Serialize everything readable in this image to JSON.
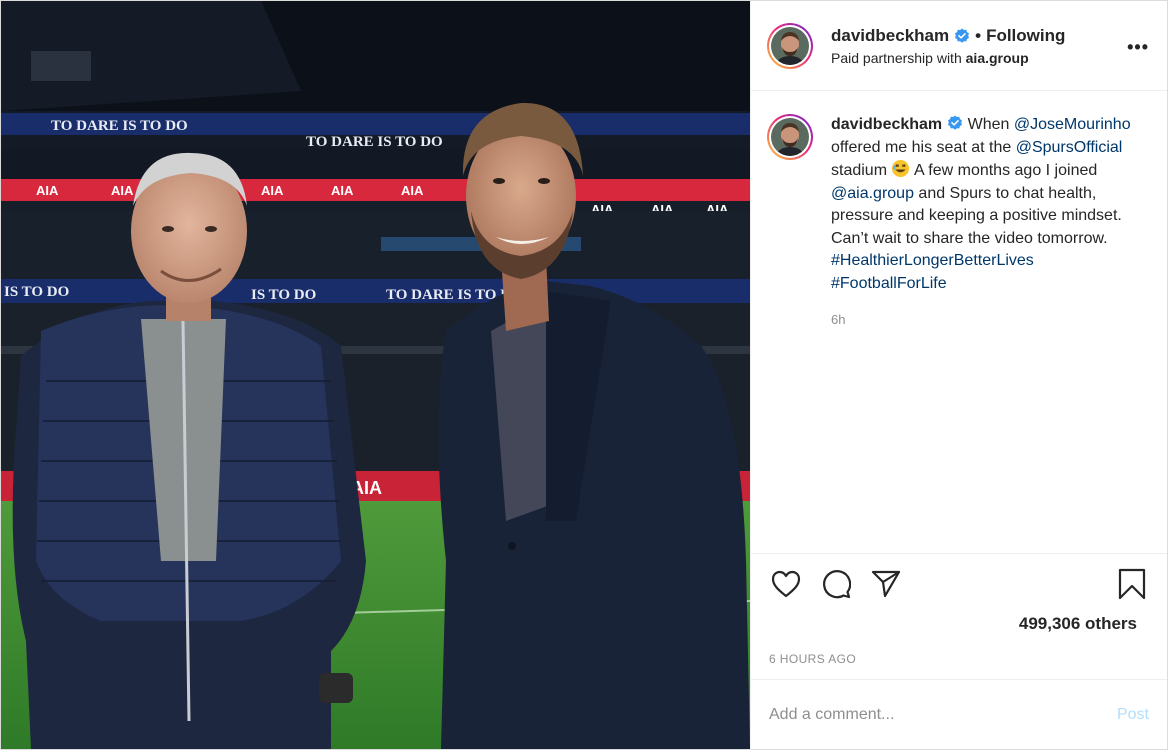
{
  "post": {
    "username": "davidbeckham",
    "separator": "•",
    "follow_status": "Following",
    "paid_partnership_prefix": "Paid partnership with ",
    "partner": "aia.group",
    "more_label": "•••"
  },
  "photo": {
    "banner_text_1": "TO DARE IS TO DO",
    "banner_text_2": "AIA"
  },
  "caption": {
    "username": "davidbeckham",
    "parts": {
      "p1": " When ",
      "mention1": "@JoseMourinho",
      "p2": " offered me his seat at the ",
      "mention2": "@SpursOfficial",
      "p3": " stadium ",
      "p4": " A few months ago I joined ",
      "mention3": "@aia.group",
      "p5": " and Spurs to chat health, pressure and keeping a positive mindset. Can’t wait to share the video tomorrow.",
      "hashtag1": "#HealthierLongerBetterLives",
      "hashtag2": "#FootballForLife"
    },
    "time": "6h"
  },
  "actions": {
    "likes": "499,306 others",
    "time_ago": "6 HOURS AGO"
  },
  "comment": {
    "placeholder": "Add a comment...",
    "post_label": "Post"
  },
  "colors": {
    "link": "#00376b",
    "verified": "#3897f0",
    "post_button_disabled": "#b2dffc"
  }
}
